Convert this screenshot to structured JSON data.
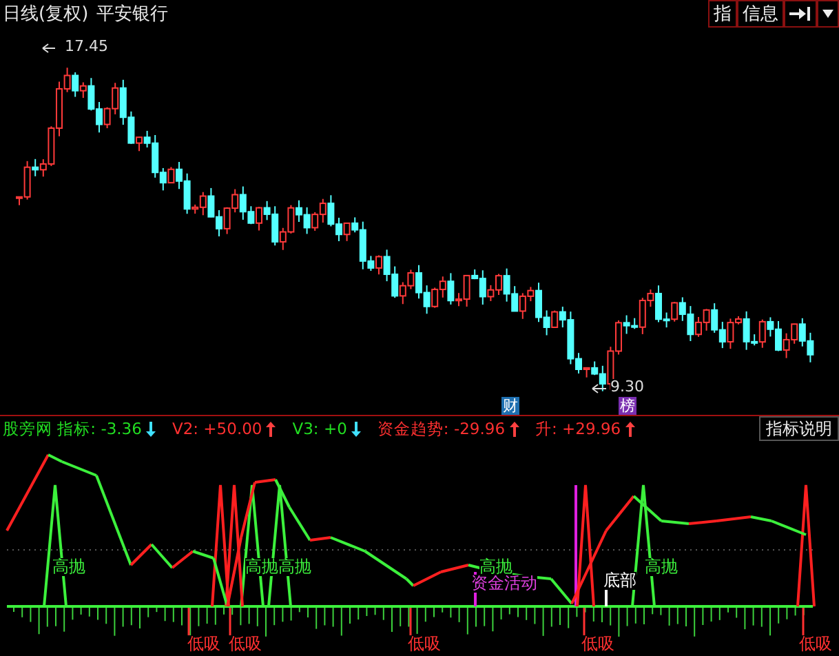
{
  "header": {
    "period": "日线(复权)",
    "stock": "平安银行",
    "buttons": [
      "指",
      "信息"
    ]
  },
  "price_chart": {
    "high_label": "17.45",
    "low_label": "9.30",
    "events": [
      {
        "label": "财",
        "color": "#1e6fb0"
      },
      {
        "label": "榜",
        "color": "#7a2fb0"
      }
    ]
  },
  "indicator": {
    "items": [
      {
        "label": "股旁网 指标:",
        "value": "-3.36",
        "rising": false,
        "color": "#22dd22"
      },
      {
        "label": "V2:",
        "value": "+50.00",
        "rising": true,
        "color": "#ff3030"
      },
      {
        "label": "V3:",
        "value": "+0",
        "rising": false,
        "color": "#22dd22"
      },
      {
        "label": "资金趋势:",
        "value": "-29.96",
        "rising": true,
        "color": "#ff3030"
      },
      {
        "label": "升:",
        "value": "+29.96",
        "rising": true,
        "color": "#ff3030"
      }
    ],
    "help_button": "指标说明",
    "signals": [
      {
        "label": "高抛",
        "kind": "sell"
      },
      {
        "label": "高抛",
        "kind": "sell"
      },
      {
        "label": "高抛",
        "kind": "sell"
      },
      {
        "label": "高抛",
        "kind": "sell"
      },
      {
        "label": "资金活动",
        "kind": "fund"
      },
      {
        "label": "底部",
        "kind": "bottom"
      },
      {
        "label": "高抛",
        "kind": "sell"
      },
      {
        "label": "低吸",
        "kind": "buy"
      },
      {
        "label": "低吸",
        "kind": "buy"
      },
      {
        "label": "低吸",
        "kind": "buy"
      },
      {
        "label": "低吸",
        "kind": "buy"
      },
      {
        "label": "低吸",
        "kind": "buy"
      }
    ]
  }
}
